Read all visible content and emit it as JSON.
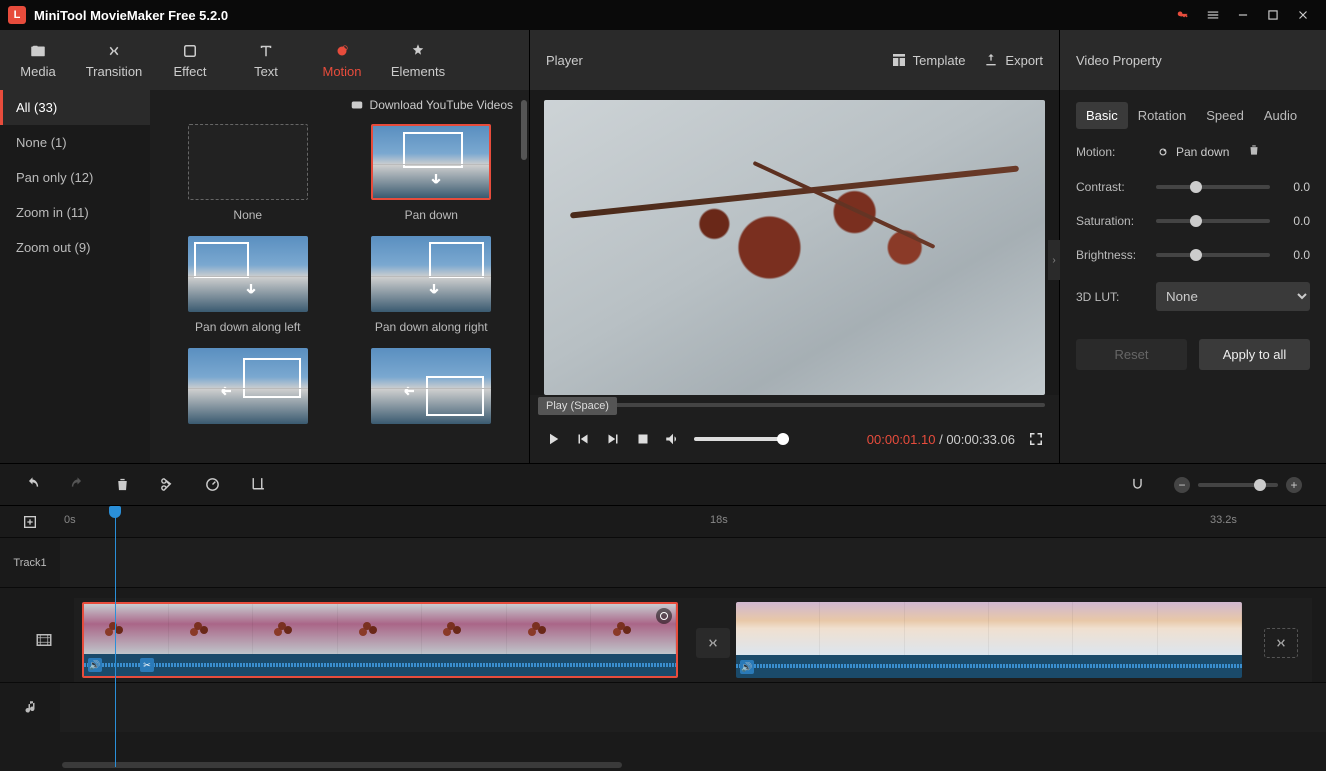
{
  "app": {
    "title": "MiniTool MovieMaker Free 5.2.0"
  },
  "libtabs": [
    {
      "icon": "folder",
      "label": "Media"
    },
    {
      "icon": "transition",
      "label": "Transition"
    },
    {
      "icon": "effect",
      "label": "Effect"
    },
    {
      "icon": "text",
      "label": "Text"
    },
    {
      "icon": "motion",
      "label": "Motion"
    },
    {
      "icon": "elements",
      "label": "Elements"
    }
  ],
  "libtabs_active": 4,
  "download_label": "Download YouTube Videos",
  "categories": [
    {
      "label": "All (33)",
      "active": true
    },
    {
      "label": "None (1)"
    },
    {
      "label": "Pan only (12)"
    },
    {
      "label": "Zoom in (11)"
    },
    {
      "label": "Zoom out (9)"
    }
  ],
  "motions": [
    {
      "label": "None",
      "type": "none"
    },
    {
      "label": "Pan down",
      "type": "scene",
      "selected": true,
      "rect": "top-center",
      "arrow": "down"
    },
    {
      "label": "Pan down along left",
      "type": "scene",
      "rect": "top-left",
      "arrow": "down"
    },
    {
      "label": "Pan down along right",
      "type": "scene",
      "rect": "top-right",
      "arrow": "down"
    },
    {
      "label": "",
      "type": "scene",
      "rect": "right",
      "arrow": "left"
    },
    {
      "label": "",
      "type": "scene",
      "rect": "bottom-right",
      "arrow": "left"
    }
  ],
  "player": {
    "title": "Player",
    "template": "Template",
    "export": "Export",
    "tooltip": "Play (Space)",
    "current": "00:00:01.10",
    "sep": " / ",
    "total": "00:00:33.06"
  },
  "props": {
    "title": "Video Property",
    "tabs": [
      "Basic",
      "Rotation",
      "Speed",
      "Audio"
    ],
    "tabs_active": 0,
    "motion_label": "Motion:",
    "motion_value": "Pan down",
    "rows": [
      {
        "label": "Contrast:",
        "value": "0.0"
      },
      {
        "label": "Saturation:",
        "value": "0.0"
      },
      {
        "label": "Brightness:",
        "value": "0.0"
      }
    ],
    "lut_label": "3D LUT:",
    "lut_value": "None",
    "reset": "Reset",
    "apply": "Apply to all"
  },
  "timeline": {
    "ruler": [
      "0s",
      "18s",
      "33.2s"
    ],
    "track_label": "Track1"
  }
}
